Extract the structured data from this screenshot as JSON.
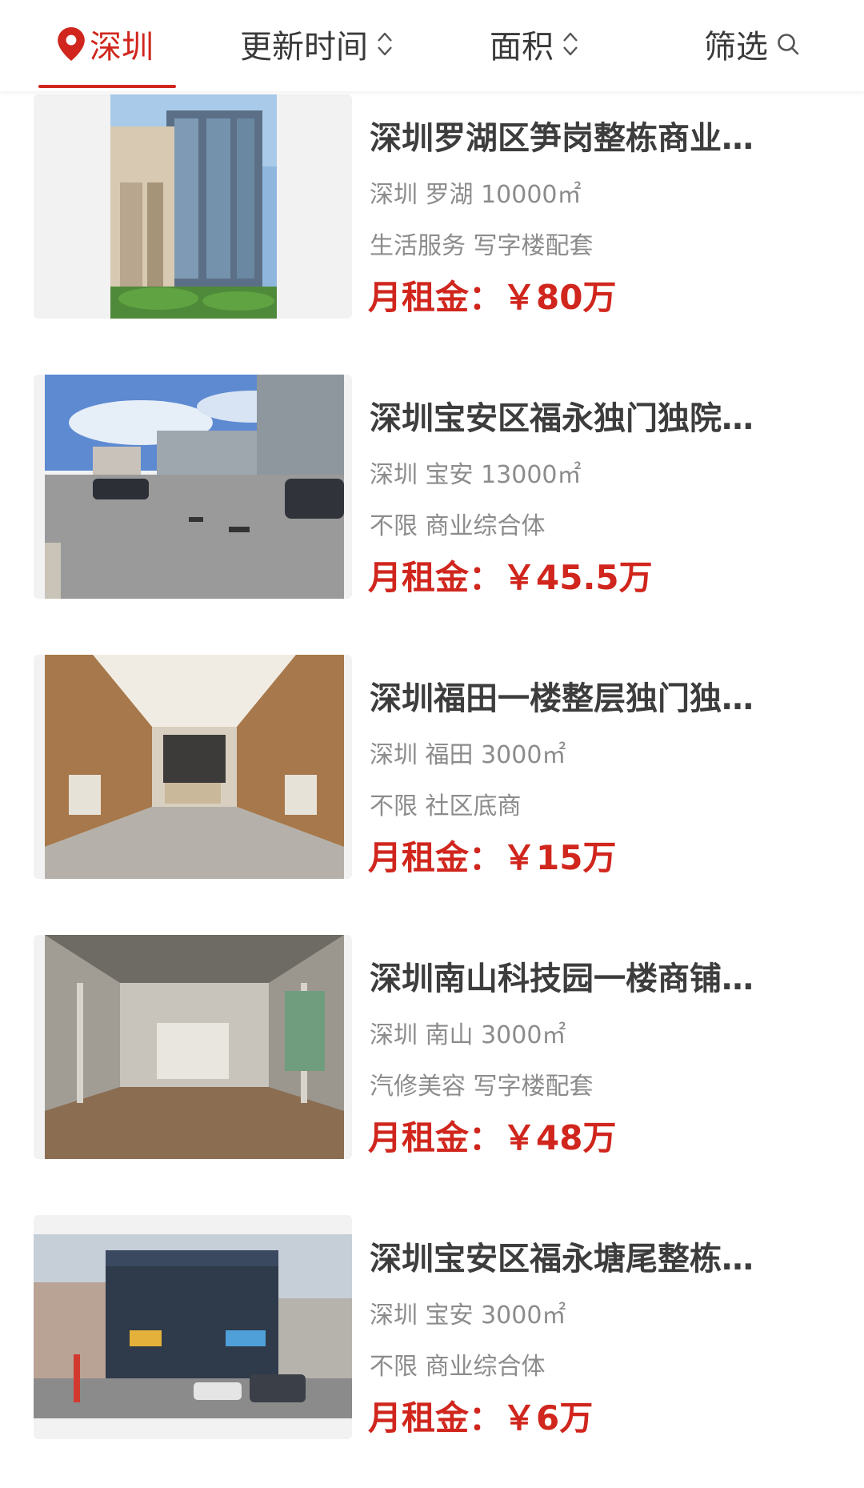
{
  "filter_bar": {
    "city": "深圳",
    "update_time": "更新时间",
    "area": "面积",
    "filter": "筛选"
  },
  "listings": [
    {
      "title": "深圳罗湖区笋岗整栋商业…",
      "meta": "深圳 罗湖 10000㎡",
      "tags": "生活服务 写字楼配套",
      "price": "月租金：￥80万"
    },
    {
      "title": "深圳宝安区福永独门独院…",
      "meta": "深圳 宝安 13000㎡",
      "tags": "不限 商业综合体",
      "price": "月租金：￥45.5万"
    },
    {
      "title": "深圳福田一楼整层独门独…",
      "meta": "深圳 福田 3000㎡",
      "tags": "不限 社区底商",
      "price": "月租金：￥15万"
    },
    {
      "title": "深圳南山科技园一楼商铺…",
      "meta": "深圳 南山 3000㎡",
      "tags": "汽修美容 写字楼配套",
      "price": "月租金：￥48万"
    },
    {
      "title": "深圳宝安区福永塘尾整栋…",
      "meta": "深圳 宝安 3000㎡",
      "tags": "不限 商业综合体",
      "price": "月租金：￥6万"
    }
  ],
  "colors": {
    "accent": "#d0261d",
    "title": "#3d3d3d",
    "secondary": "#8c8c8c"
  },
  "icons": [
    "location-pin-icon",
    "sort-arrows-icon",
    "search-icon"
  ]
}
